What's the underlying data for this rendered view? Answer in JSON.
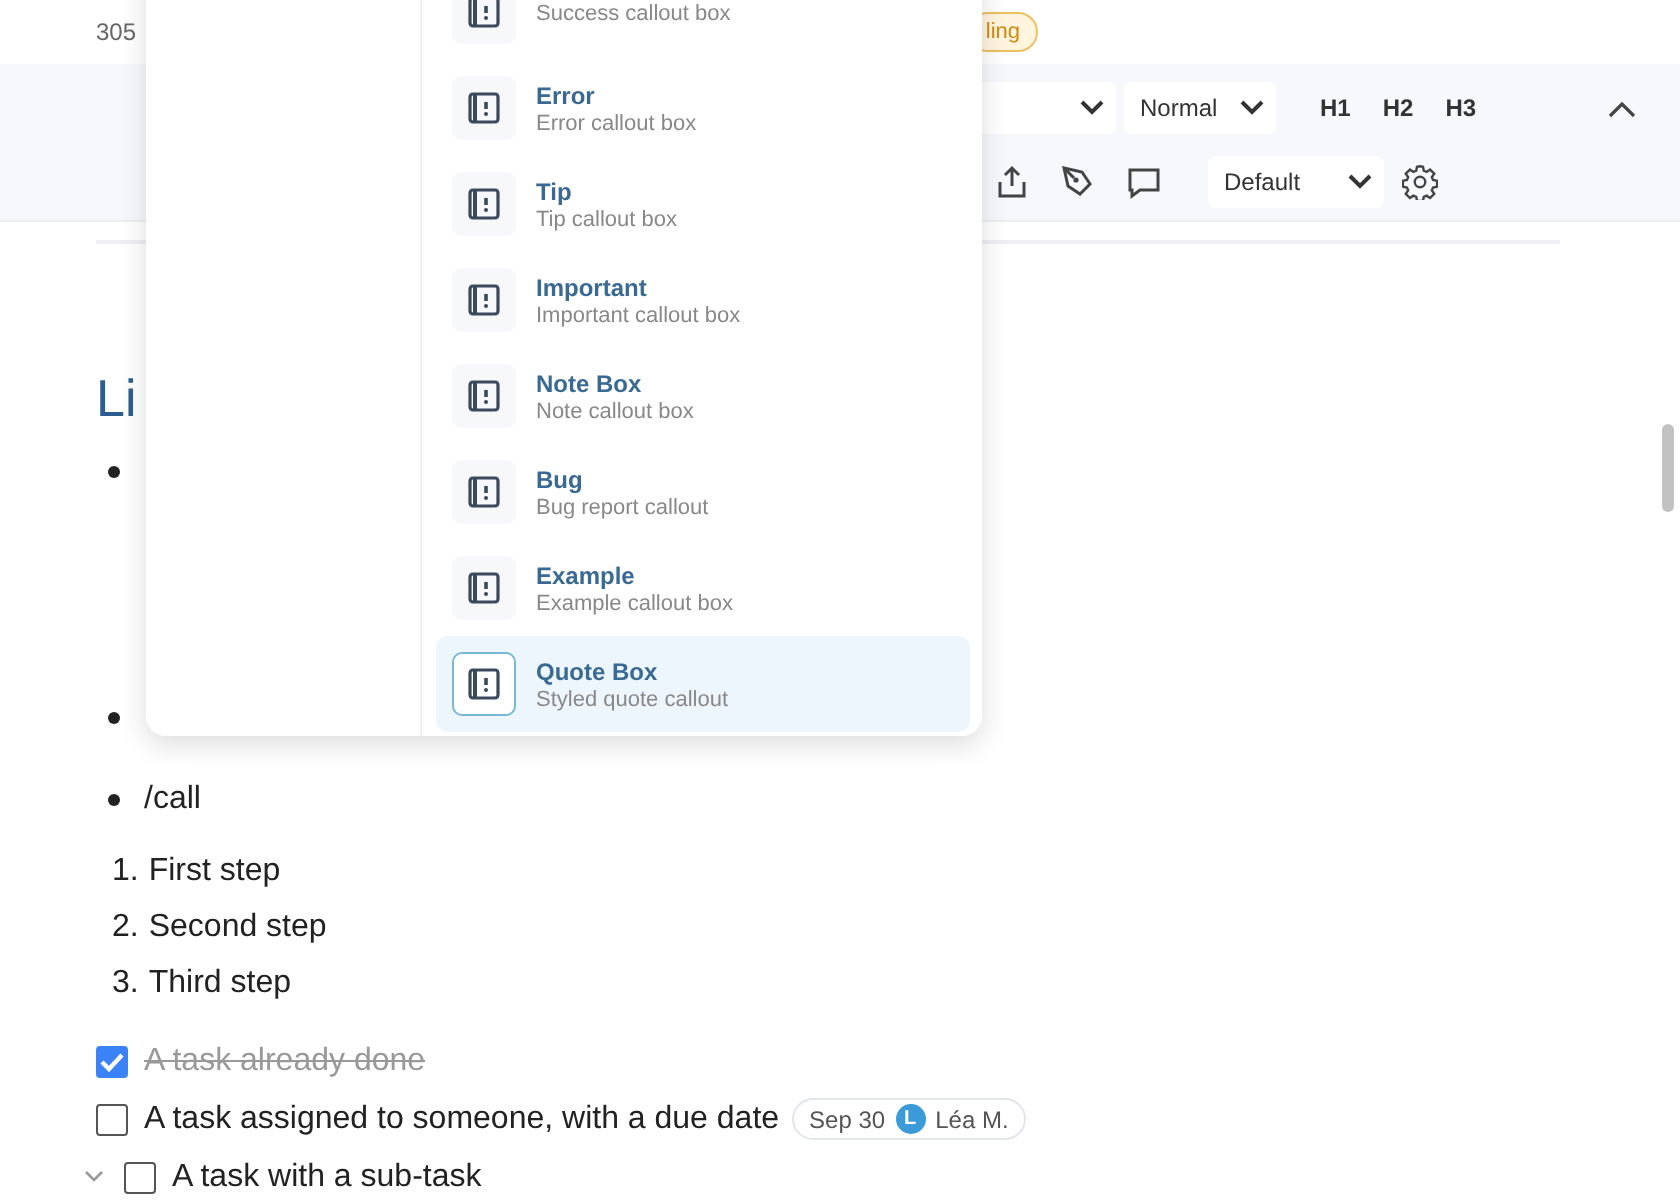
{
  "top_bar": {
    "count_text": "305",
    "badge": "ling"
  },
  "toolbar": {
    "row1": {
      "style_select": "Normal",
      "headings": [
        "H1",
        "H2",
        "H3"
      ]
    },
    "row2": {
      "theme_select": "Default"
    }
  },
  "document": {
    "heading": "Li",
    "bullets": [
      {
        "kind": "covered"
      },
      {
        "kind": "covered"
      },
      {
        "kind": "text",
        "text": "/call"
      }
    ],
    "steps": [
      {
        "number": "1.",
        "text": "First step"
      },
      {
        "number": "2.",
        "text": "Second step"
      },
      {
        "number": "3.",
        "text": "Third step"
      }
    ],
    "tasks": [
      {
        "checked": true,
        "text": "A task already done"
      },
      {
        "checked": false,
        "text": "A task assigned to someone, with a due date",
        "due": "Sep 30",
        "assignee_initial": "L",
        "assignee": "Léa M."
      },
      {
        "checked": false,
        "text": "A task with a sub-task",
        "expanded": true
      }
    ]
  },
  "callout_menu": {
    "items": [
      {
        "subtitle": "Success callout box",
        "selected": false
      },
      {
        "title": "Error",
        "subtitle": "Error callout box",
        "selected": false
      },
      {
        "title": "Tip",
        "subtitle": "Tip callout box",
        "selected": false
      },
      {
        "title": "Important",
        "subtitle": "Important callout box",
        "selected": false
      },
      {
        "title": "Note Box",
        "subtitle": "Note callout box",
        "selected": false
      },
      {
        "title": "Bug",
        "subtitle": "Bug report callout",
        "selected": false
      },
      {
        "title": "Example",
        "subtitle": "Example callout box",
        "selected": false
      },
      {
        "title": "Quote Box",
        "subtitle": "Styled quote callout",
        "selected": true
      }
    ]
  }
}
